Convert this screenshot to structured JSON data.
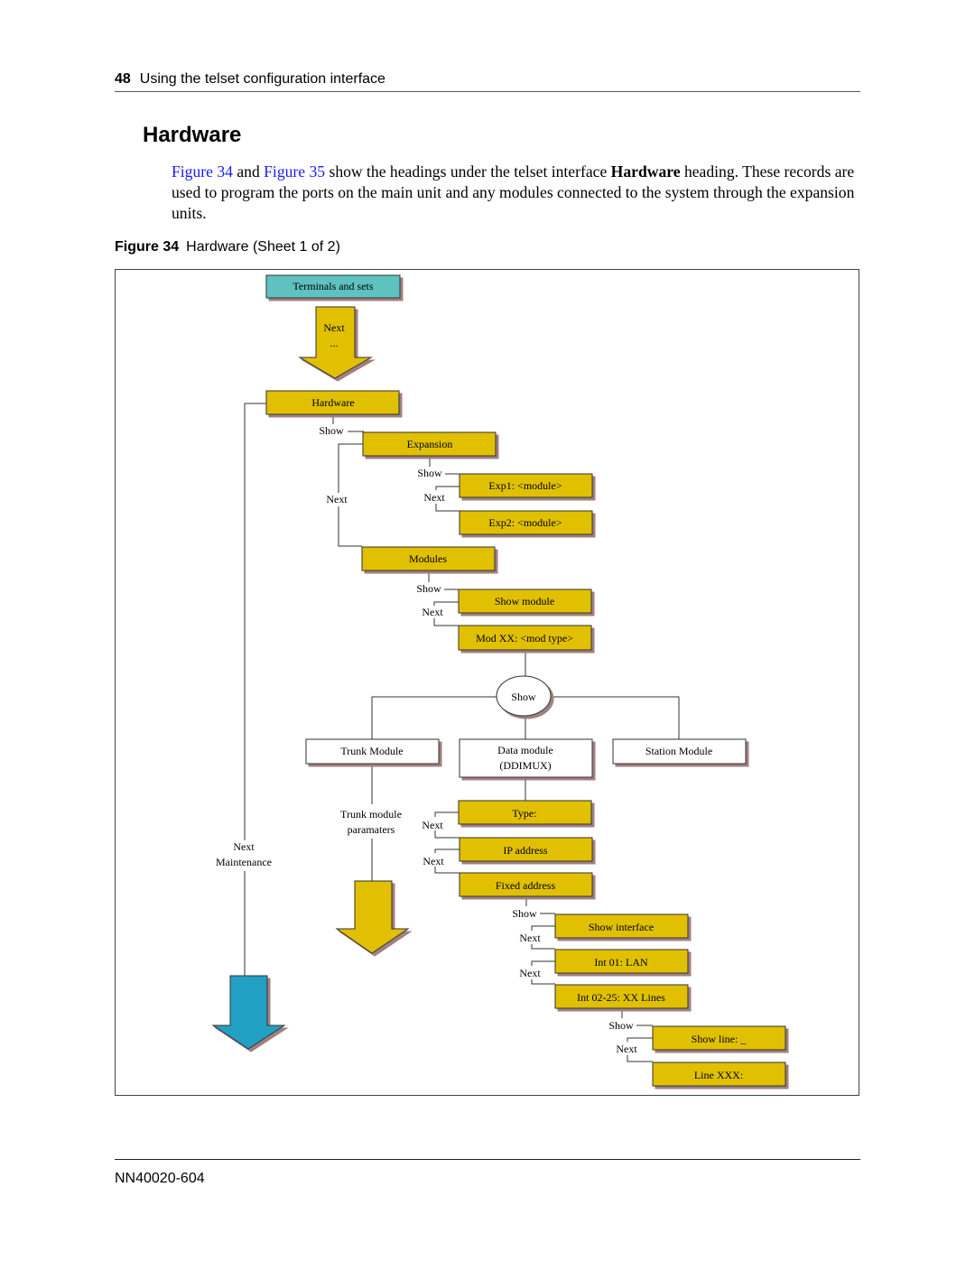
{
  "header": {
    "page_number": "48",
    "running_title": "Using the telset configuration interface"
  },
  "section_title": "Hardware",
  "paragraph": {
    "link1": "Figure 34",
    "text1": " and ",
    "link2": "Figure 35",
    "text2": " show the headings under the telset interface ",
    "bold": "Hardware",
    "text3": " heading. These records are used to program the ports on the main unit and any modules connected to the system through the expansion units."
  },
  "figure": {
    "label": "Figure 34",
    "caption": "Hardware (Sheet 1 of 2)"
  },
  "colors": {
    "yellow_box": "#e0c000",
    "teal_box": "#5fc2c0",
    "blue_arrow": "#22a0c4",
    "link": "#1a1aff"
  },
  "diagram": {
    "terminals": "Terminals and sets",
    "arrow_next": "Next",
    "arrow_dots": "...",
    "hardware": "Hardware",
    "show": "Show",
    "next": "Next",
    "expansion": "Expansion",
    "exp1": "Exp1: <module>",
    "exp2": "Exp2: <module>",
    "modules": "Modules",
    "show_module": "Show module",
    "mod_xx": "Mod XX: <mod type>",
    "show_oval": "Show",
    "trunk_module": "Trunk Module",
    "data_module_1": "Data module",
    "data_module_2": "(DDIMUX)",
    "station_module": "Station Module",
    "trunk_params_1": "Trunk module",
    "trunk_params_2": "paramaters",
    "type": "Type:",
    "ip_address": "IP address",
    "fixed_address": "Fixed address",
    "show_interface": "Show interface",
    "int01": "Int 01: LAN",
    "int0225": "Int 02-25: XX Lines",
    "show_line": "Show line: _",
    "line_xxx": "Line XXX:",
    "next_maint_1": "Next",
    "next_maint_2": "Maintenance"
  },
  "footer": {
    "doc_number": "NN40020-604"
  }
}
